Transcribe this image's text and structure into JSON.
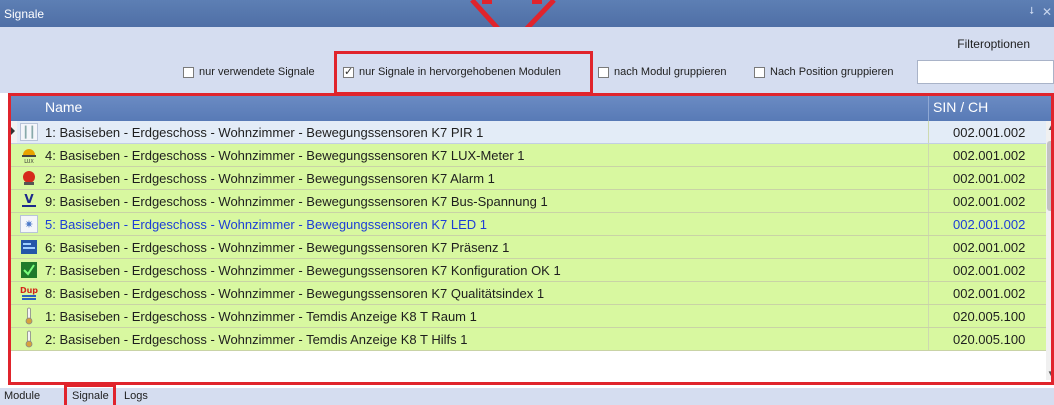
{
  "window": {
    "title": "Signale",
    "pin_icon": "pin-icon",
    "close_icon": "close-icon"
  },
  "filter": {
    "options_label": "Filteroptionen",
    "checkboxes": [
      {
        "label": "nur verwendete Signale",
        "checked": false
      },
      {
        "label": "nur Signale in hervorgehobenen Modulen",
        "checked": true
      },
      {
        "label": "nach Modul gruppieren",
        "checked": false
      },
      {
        "label": "Nach Position gruppieren",
        "checked": false
      }
    ],
    "search_value": ""
  },
  "grid": {
    "columns": {
      "name": "Name",
      "sin": "SIN / CH"
    },
    "rows": [
      {
        "icon": "module-icon",
        "name": "1: Basiseben - Erdgeschoss - Wohnzimmer - Bewegungssensoren K7 PIR 1",
        "sin": "002.001.002"
      },
      {
        "icon": "lux-meter-icon",
        "name": "4: Basiseben - Erdgeschoss - Wohnzimmer - Bewegungssensoren K7 LUX-Meter 1",
        "sin": "002.001.002"
      },
      {
        "icon": "alarm-icon",
        "name": "2: Basiseben - Erdgeschoss - Wohnzimmer - Bewegungssensoren K7 Alarm 1",
        "sin": "002.001.002"
      },
      {
        "icon": "voltage-icon",
        "name": "9: Basiseben - Erdgeschoss - Wohnzimmer - Bewegungssensoren K7 Bus-Spannung 1",
        "sin": "002.001.002"
      },
      {
        "icon": "led-icon",
        "name": "5: Basiseben - Erdgeschoss - Wohnzimmer - Bewegungssensoren K7 LED 1",
        "sin": "002.001.002"
      },
      {
        "icon": "presence-icon",
        "name": "6: Basiseben - Erdgeschoss - Wohnzimmer - Bewegungssensoren K7 Präsenz 1",
        "sin": "002.001.002"
      },
      {
        "icon": "config-ok-icon",
        "name": "7: Basiseben - Erdgeschoss - Wohnzimmer - Bewegungssensoren K7 Konfiguration OK 1",
        "sin": "002.001.002"
      },
      {
        "icon": "dup-icon",
        "name": "8: Basiseben - Erdgeschoss - Wohnzimmer - Bewegungssensoren K7 Qualitätsindex 1",
        "sin": "002.001.002"
      },
      {
        "icon": "thermometer-icon",
        "name": "1: Basiseben - Erdgeschoss - Wohnzimmer - Temdis Anzeige K8 T Raum 1",
        "sin": "020.005.100"
      },
      {
        "icon": "thermometer-icon",
        "name": "2: Basiseben - Erdgeschoss - Wohnzimmer - Temdis Anzeige K8 T Hilfs 1",
        "sin": "020.005.100"
      }
    ]
  },
  "tabs": [
    {
      "label": "Module"
    },
    {
      "label": "Signale"
    },
    {
      "label": "Logs"
    }
  ],
  "colors": {
    "highlight_red": "#e0242c",
    "row_green": "#d8f8a0",
    "header_blue": "#587ab6",
    "selected_text": "#1d3ed6"
  }
}
